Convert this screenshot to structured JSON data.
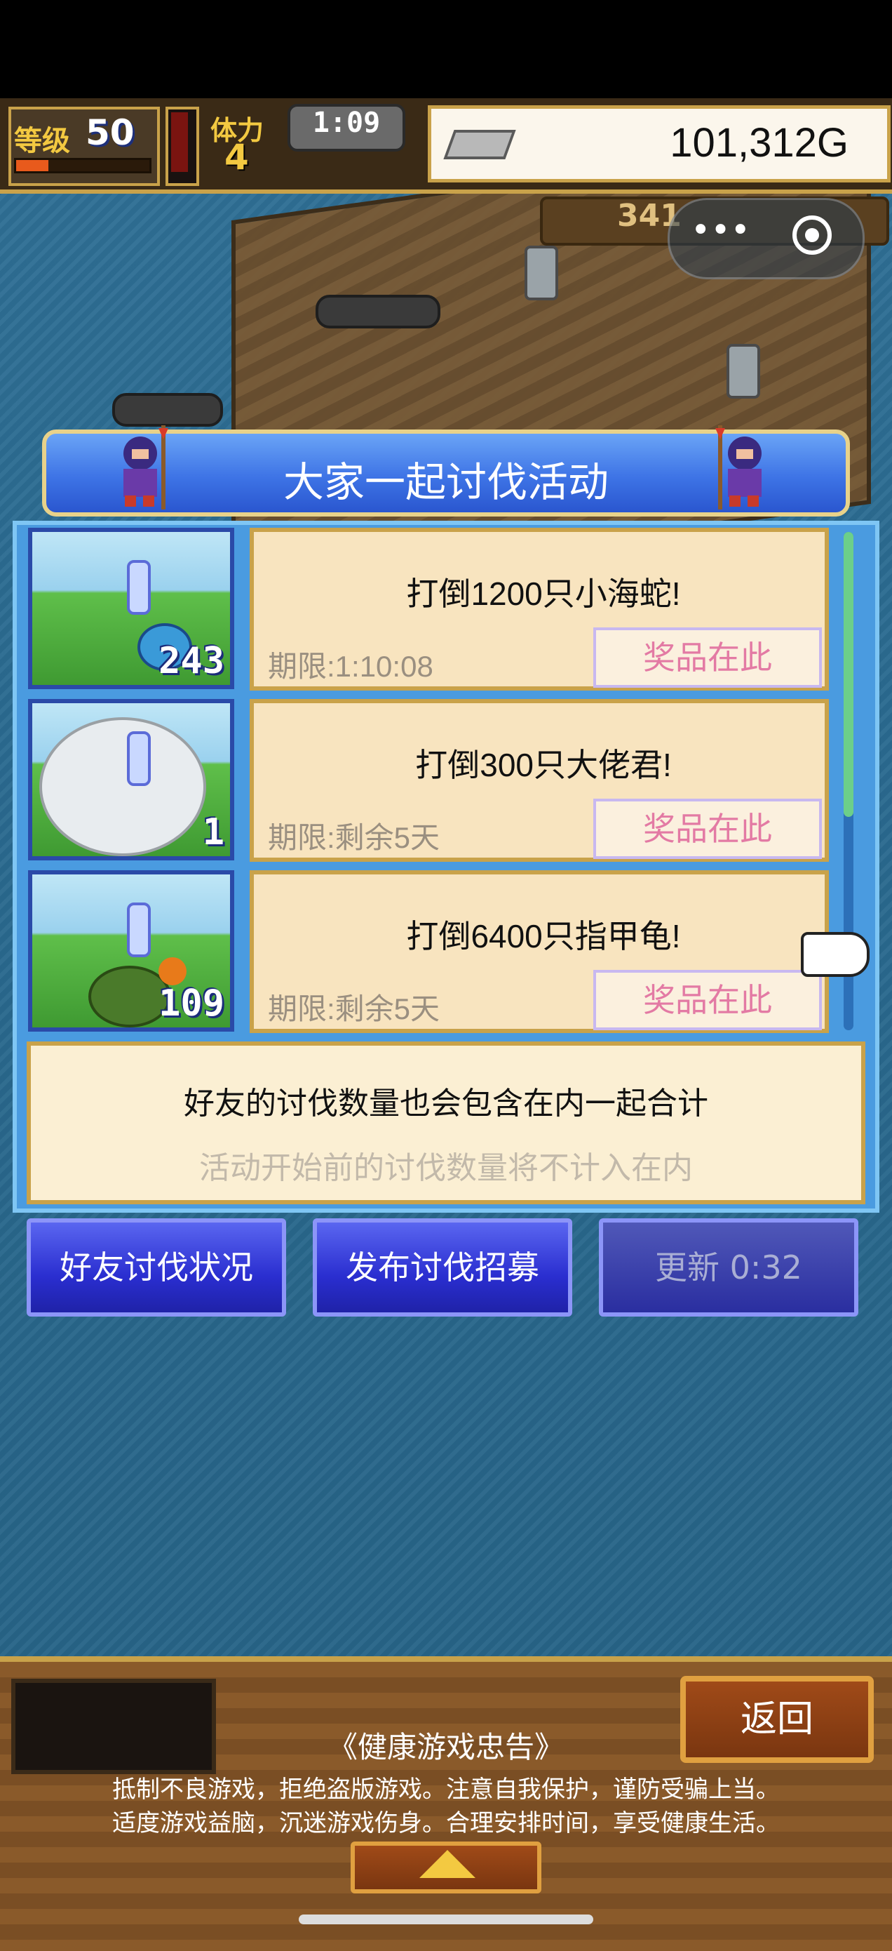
{
  "hud": {
    "level_label": "等级",
    "level_value": "50",
    "level_progress": 0.25,
    "stamina_label": "体力",
    "stamina_value": "4",
    "timer": "1:09",
    "gold": "101,312G",
    "secondary_count": "341"
  },
  "dialog": {
    "title": "大家一起讨伐活动",
    "quests": [
      {
        "title": "打倒1200只小海蛇!",
        "deadline": "期限:1:10:08",
        "reward_label": "奖品在此",
        "count": "243",
        "monster": "sea-serpent"
      },
      {
        "title": "打倒300只大佬君!",
        "deadline": "期限:剩余5天",
        "reward_label": "奖品在此",
        "count": "1",
        "monster": "giant-squid"
      },
      {
        "title": "打倒6400只指甲龟!",
        "deadline": "期限:剩余5天",
        "reward_label": "奖品在此",
        "count": "109",
        "monster": "turtle"
      }
    ],
    "info_line1": "好友的讨伐数量也会包含在内一起合计",
    "info_line2": "活动开始前的讨伐数量将不计入在内",
    "buttons": {
      "friend_status": "好友讨伐状况",
      "post_recruit": "发布讨伐招募",
      "refresh": "更新 0:32"
    }
  },
  "bottom": {
    "back": "返回",
    "notice_title": "《健康游戏忠告》",
    "notice_line1": "抵制不良游戏，拒绝盗版游戏。注意自我保护，谨防受骗上当。",
    "notice_line2": "适度游戏益脑，沉迷游戏伤身。合理安排时间，享受健康生活。"
  },
  "colors": {
    "accent_blue": "#2a2ed0",
    "reward_text": "#e37aa4",
    "gold_border": "#c9a24a"
  }
}
